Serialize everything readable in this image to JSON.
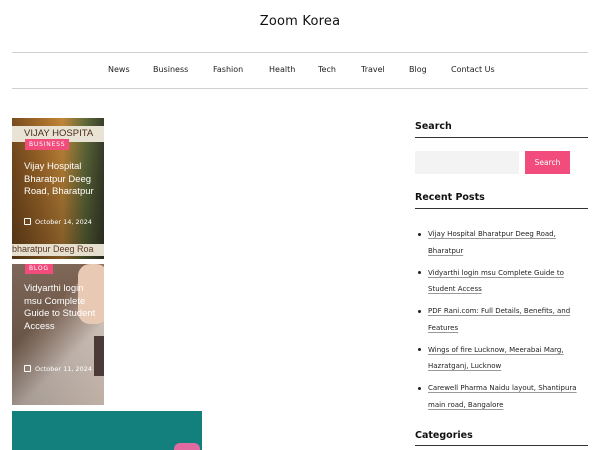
{
  "site": {
    "title": "Zoom Korea"
  },
  "nav": {
    "items": [
      {
        "label": "News"
      },
      {
        "label": "Business"
      },
      {
        "label": "Fashion"
      },
      {
        "label": "Health"
      },
      {
        "label": "Tech"
      },
      {
        "label": "Travel"
      },
      {
        "label": "Blog"
      },
      {
        "label": "Contact Us"
      }
    ]
  },
  "posts": [
    {
      "badge": "BUSINESS",
      "title": "Vijay Hospital Bharatpur Deeg Road, Bharatpur",
      "date": "October 14, 2024",
      "image_sign_top": "VIJAY HOSPITA",
      "image_sign_bottom": "bharatpur Deeg Roa"
    },
    {
      "badge": "BLOG",
      "title": "Vidyarthi login msu Complete Guide to Student Access",
      "date": "October 11, 2024"
    }
  ],
  "sidebar": {
    "search": {
      "title": "Search",
      "placeholder": "",
      "button_label": "Search"
    },
    "recent_posts": {
      "title": "Recent Posts",
      "items": [
        {
          "label": "Vijay Hospital Bharatpur Deeg Road, Bharatpur"
        },
        {
          "label": "Vidyarthi login msu Complete Guide to Student Access"
        },
        {
          "label": "PDF Rani.com: Full Details, Benefits, and Features"
        },
        {
          "label": "Wings of fire Lucknow, Meerabai Marg, Hazratganj, Lucknow"
        },
        {
          "label": "Carewell Pharma Naidu layout, Shantipura main road, Bangalore"
        }
      ]
    },
    "categories": {
      "title": "Categories"
    }
  },
  "colors": {
    "accent": "#f14c7c",
    "text": "#222222",
    "rule": "#cfcfcf"
  }
}
